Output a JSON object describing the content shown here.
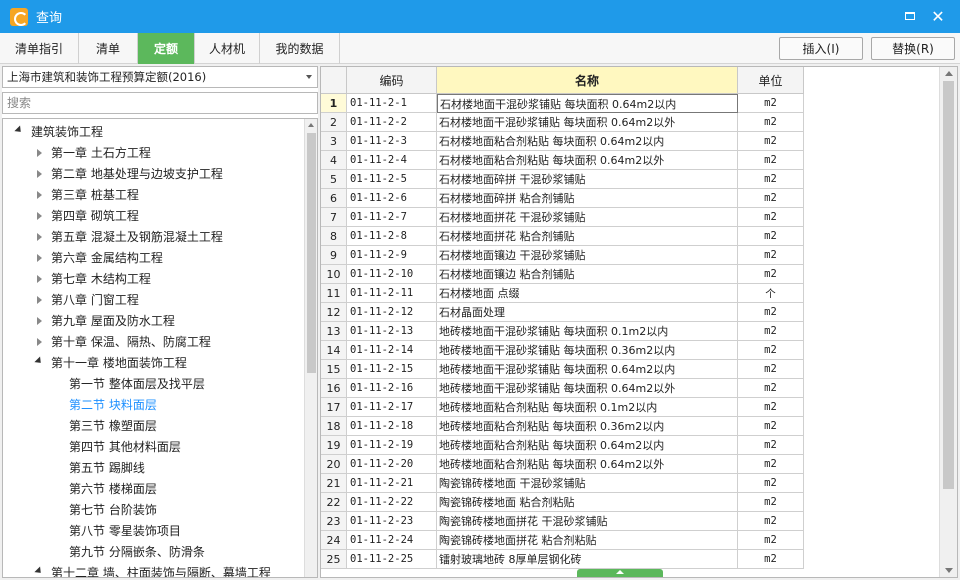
{
  "window": {
    "title": "查询"
  },
  "tabs": [
    {
      "label": "清单指引",
      "active": false
    },
    {
      "label": "清单",
      "active": false
    },
    {
      "label": "定额",
      "active": true
    },
    {
      "label": "人材机",
      "active": false
    },
    {
      "label": "我的数据",
      "active": false
    }
  ],
  "actions": {
    "insert_label": "插入(I)",
    "replace_label": "替换(R)"
  },
  "left": {
    "quota_library": "上海市建筑和装饰工程预算定额(2016)",
    "search_placeholder": "搜索"
  },
  "tree": [
    {
      "label": "建筑装饰工程",
      "level": 0,
      "state": "open"
    },
    {
      "label": "第一章 土石方工程",
      "level": 1,
      "state": "closed"
    },
    {
      "label": "第二章 地基处理与边坡支护工程",
      "level": 1,
      "state": "closed"
    },
    {
      "label": "第三章 桩基工程",
      "level": 1,
      "state": "closed"
    },
    {
      "label": "第四章 砌筑工程",
      "level": 1,
      "state": "closed"
    },
    {
      "label": "第五章 混凝土及钢筋混凝土工程",
      "level": 1,
      "state": "closed"
    },
    {
      "label": "第六章 金属结构工程",
      "level": 1,
      "state": "closed"
    },
    {
      "label": "第七章 木结构工程",
      "level": 1,
      "state": "closed"
    },
    {
      "label": "第八章 门窗工程",
      "level": 1,
      "state": "closed"
    },
    {
      "label": "第九章 屋面及防水工程",
      "level": 1,
      "state": "closed"
    },
    {
      "label": "第十章 保温、隔热、防腐工程",
      "level": 1,
      "state": "closed"
    },
    {
      "label": "第十一章 楼地面装饰工程",
      "level": 1,
      "state": "open"
    },
    {
      "label": "第一节 整体面层及找平层",
      "level": 2,
      "state": "leaf"
    },
    {
      "label": "第二节 块料面层",
      "level": 2,
      "state": "leaf",
      "selected": true
    },
    {
      "label": "第三节 橡塑面层",
      "level": 2,
      "state": "leaf"
    },
    {
      "label": "第四节 其他材料面层",
      "level": 2,
      "state": "leaf"
    },
    {
      "label": "第五节 踢脚线",
      "level": 2,
      "state": "leaf"
    },
    {
      "label": "第六节 楼梯面层",
      "level": 2,
      "state": "leaf"
    },
    {
      "label": "第七节 台阶装饰",
      "level": 2,
      "state": "leaf"
    },
    {
      "label": "第八节 零星装饰项目",
      "level": 2,
      "state": "leaf"
    },
    {
      "label": "第九节 分隔嵌条、防滑条",
      "level": 2,
      "state": "leaf"
    },
    {
      "label": "第十二章 墙、柱面装饰与隔断、幕墙工程",
      "level": 1,
      "state": "open"
    }
  ],
  "grid": {
    "headers": {
      "code": "编码",
      "name": "名称",
      "unit": "单位"
    },
    "rows": [
      {
        "idx": "1",
        "code": "01-11-2-1",
        "name": "石材楼地面干混砂浆铺贴 每块面积 0.64m2以内",
        "unit": "m2"
      },
      {
        "idx": "2",
        "code": "01-11-2-2",
        "name": "石材楼地面干混砂浆铺贴 每块面积 0.64m2以外",
        "unit": "m2"
      },
      {
        "idx": "3",
        "code": "01-11-2-3",
        "name": "石材楼地面粘合剂粘贴 每块面积 0.64m2以内",
        "unit": "m2"
      },
      {
        "idx": "4",
        "code": "01-11-2-4",
        "name": "石材楼地面粘合剂粘贴 每块面积 0.64m2以外",
        "unit": "m2"
      },
      {
        "idx": "5",
        "code": "01-11-2-5",
        "name": "石材楼地面碎拼 干混砂浆铺贴",
        "unit": "m2"
      },
      {
        "idx": "6",
        "code": "01-11-2-6",
        "name": "石材楼地面碎拼 粘合剂铺贴",
        "unit": "m2"
      },
      {
        "idx": "7",
        "code": "01-11-2-7",
        "name": "石材楼地面拼花 干混砂浆铺贴",
        "unit": "m2"
      },
      {
        "idx": "8",
        "code": "01-11-2-8",
        "name": "石材楼地面拼花 粘合剂铺贴",
        "unit": "m2"
      },
      {
        "idx": "9",
        "code": "01-11-2-9",
        "name": "石材楼地面镶边 干混砂浆铺贴",
        "unit": "m2"
      },
      {
        "idx": "10",
        "code": "01-11-2-10",
        "name": "石材楼地面镶边 粘合剂铺贴",
        "unit": "m2"
      },
      {
        "idx": "11",
        "code": "01-11-2-11",
        "name": "石材楼地面 点缀",
        "unit": "个"
      },
      {
        "idx": "12",
        "code": "01-11-2-12",
        "name": "石材晶面处理",
        "unit": "m2"
      },
      {
        "idx": "13",
        "code": "01-11-2-13",
        "name": "地砖楼地面干混砂浆铺贴 每块面积 0.1m2以内",
        "unit": "m2"
      },
      {
        "idx": "14",
        "code": "01-11-2-14",
        "name": "地砖楼地面干混砂浆铺贴 每块面积 0.36m2以内",
        "unit": "m2"
      },
      {
        "idx": "15",
        "code": "01-11-2-15",
        "name": "地砖楼地面干混砂浆铺贴 每块面积 0.64m2以内",
        "unit": "m2"
      },
      {
        "idx": "16",
        "code": "01-11-2-16",
        "name": "地砖楼地面干混砂浆铺贴 每块面积 0.64m2以外",
        "unit": "m2"
      },
      {
        "idx": "17",
        "code": "01-11-2-17",
        "name": "地砖楼地面粘合剂粘贴 每块面积 0.1m2以内",
        "unit": "m2"
      },
      {
        "idx": "18",
        "code": "01-11-2-18",
        "name": "地砖楼地面粘合剂粘贴 每块面积 0.36m2以内",
        "unit": "m2"
      },
      {
        "idx": "19",
        "code": "01-11-2-19",
        "name": "地砖楼地面粘合剂粘贴 每块面积 0.64m2以内",
        "unit": "m2"
      },
      {
        "idx": "20",
        "code": "01-11-2-20",
        "name": "地砖楼地面粘合剂粘贴 每块面积 0.64m2以外",
        "unit": "m2"
      },
      {
        "idx": "21",
        "code": "01-11-2-21",
        "name": "陶瓷锦砖楼地面 干混砂浆铺贴",
        "unit": "m2"
      },
      {
        "idx": "22",
        "code": "01-11-2-22",
        "name": "陶瓷锦砖楼地面 粘合剂粘贴",
        "unit": "m2"
      },
      {
        "idx": "23",
        "code": "01-11-2-23",
        "name": "陶瓷锦砖楼地面拼花 干混砂浆铺贴",
        "unit": "m2"
      },
      {
        "idx": "24",
        "code": "01-11-2-24",
        "name": "陶瓷锦砖楼地面拼花 粘合剂粘贴",
        "unit": "m2"
      },
      {
        "idx": "25",
        "code": "01-11-2-25",
        "name": "镭射玻璃地砖 8厚单层钢化砖",
        "unit": "m2"
      }
    ]
  },
  "colors": {
    "titlebar": "#1f9ae9",
    "active_tab": "#5cb85c",
    "selected_text": "#1e90ff",
    "header_highlight": "#fff8c0"
  },
  "icons": {
    "app": "app-logo-icon",
    "maximize": "maximize-icon",
    "close": "close-icon"
  }
}
